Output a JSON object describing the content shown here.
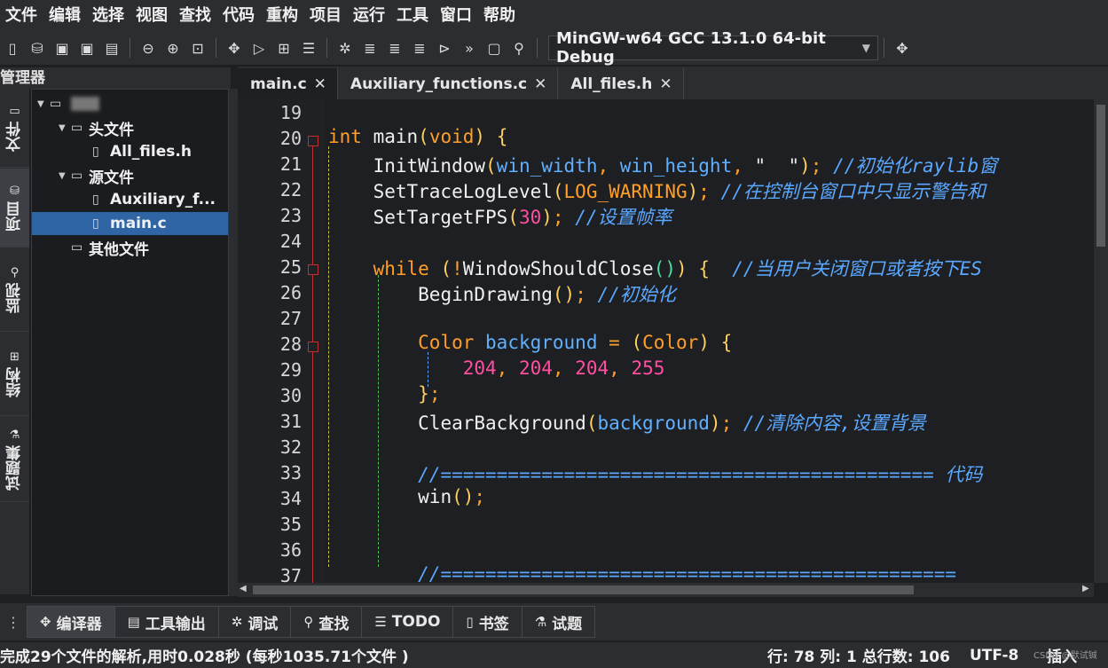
{
  "menu": [
    "文件",
    "编辑",
    "选择",
    "视图",
    "查找",
    "代码",
    "重构",
    "项目",
    "运行",
    "工具",
    "窗口",
    "帮助"
  ],
  "toolbar": {
    "compiler": "MinGW-w64 GCC 13.1.0 64-bit Debug"
  },
  "manager": {
    "title": "管理器"
  },
  "vtabs": [
    {
      "label": "文件",
      "icon": "file-icon"
    },
    {
      "label": "项目",
      "icon": "project-icon"
    },
    {
      "label": "监视",
      "icon": "watch-icon"
    },
    {
      "label": "结构",
      "icon": "structure-icon"
    },
    {
      "label": "试题集",
      "icon": "problem-set-icon"
    }
  ],
  "tree": [
    {
      "label": "",
      "level": 0,
      "type": "folder",
      "expanded": true
    },
    {
      "label": "头文件",
      "level": 1,
      "type": "folder",
      "expanded": true
    },
    {
      "label": "All_files.h",
      "level": 2,
      "type": "file"
    },
    {
      "label": "源文件",
      "level": 1,
      "type": "folder",
      "expanded": true
    },
    {
      "label": "Auxiliary_f...",
      "level": 2,
      "type": "file"
    },
    {
      "label": "main.c",
      "level": 2,
      "type": "file",
      "selected": true
    },
    {
      "label": "其他文件",
      "level": 1,
      "type": "folder"
    }
  ],
  "tabs": [
    {
      "label": "main.c",
      "active": true
    },
    {
      "label": "Auxiliary_functions.c",
      "active": false
    },
    {
      "label": "All_files.h",
      "active": false
    }
  ],
  "code": {
    "line_numbers": [
      "19",
      "20",
      "21",
      "22",
      "23",
      "24",
      "25",
      "26",
      "27",
      "28",
      "29",
      "30",
      "31",
      "32",
      "33",
      "34",
      "35",
      "36",
      "37"
    ],
    "fold_lines": [
      "20",
      "25",
      "28"
    ],
    "lines": [
      "",
      "int main(void) {",
      "    InitWindow(win_width, win_height, \"  \"); //初始化raylib窗",
      "    SetTraceLogLevel(LOG_WARNING); //在控制台窗口中只显示警告和",
      "    SetTargetFPS(30); //设置帧率",
      "",
      "    while (!WindowShouldClose()) {  //当用户关闭窗口或者按下ES",
      "        BeginDrawing(); //初始化",
      "",
      "        Color background = (Color) {",
      "            204, 204, 204, 255",
      "        };",
      "        ClearBackground(background); //清除内容,设置背景",
      "",
      "        //============================================ 代码",
      "        win();",
      "",
      "",
      "        //=============================================="
    ]
  },
  "bottom_tabs": [
    {
      "label": "编译器",
      "icon": "compiler-icon",
      "active": true
    },
    {
      "label": "工具输出",
      "icon": "tool-output-icon",
      "active": false
    },
    {
      "label": "调试",
      "icon": "debug-icon",
      "active": false
    },
    {
      "label": "查找",
      "icon": "search-icon",
      "active": false
    },
    {
      "label": "TODO",
      "icon": "todo-icon",
      "active": false
    },
    {
      "label": "书签",
      "icon": "bookmark-icon",
      "active": false
    },
    {
      "label": "试题",
      "icon": "problem-icon",
      "active": false
    }
  ],
  "status": {
    "message": "完成29个文件的解析,用时0.028秒 (每秒1035.71个文件 )",
    "position": "行: 78 列: 1 总行数: 106",
    "encoding": "UTF-8",
    "mode": "插入",
    "watermark": "CSDN @默试铖"
  }
}
